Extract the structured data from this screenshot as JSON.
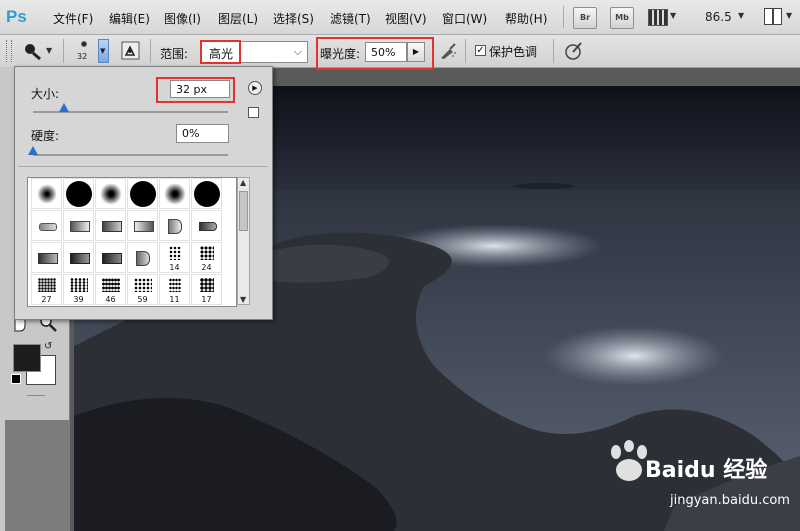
{
  "app": {
    "logo_text": "Ps",
    "menus": [
      "文件(F)",
      "编辑(E)",
      "图像(I)",
      "图层(L)",
      "选择(S)",
      "滤镜(T)",
      "视图(V)",
      "窗口(W)",
      "帮助(H)"
    ],
    "bridge_label": "Br",
    "minibridge_label": "Mb",
    "zoom_value": "86.5"
  },
  "options": {
    "brush_size_label": "32",
    "range_label": "范围:",
    "range_value": "高光",
    "exposure_label": "曝光度:",
    "exposure_value": "50%",
    "protect_tones_label": "保护色调",
    "protect_tones_checked": true
  },
  "brush_panel": {
    "size_label": "大小:",
    "size_value": "32 px",
    "size_fraction": 0.16,
    "hardness_label": "硬度:",
    "hardness_value": "0%",
    "hardness_fraction": 0.0,
    "presets_row1": [
      "",
      "",
      "",
      "",
      "",
      ""
    ],
    "presets_row4": [
      "27",
      "39",
      "46",
      "59",
      "11",
      "17"
    ],
    "presets_row3_nums": [
      "14",
      "24"
    ]
  },
  "watermark": {
    "brand": "Baidu 经验",
    "url": "jingyan.baidu.com"
  },
  "colors": {
    "accent": "#2a6fc9",
    "highlight": "#e63131",
    "ps_blue": "#27a0d8"
  }
}
